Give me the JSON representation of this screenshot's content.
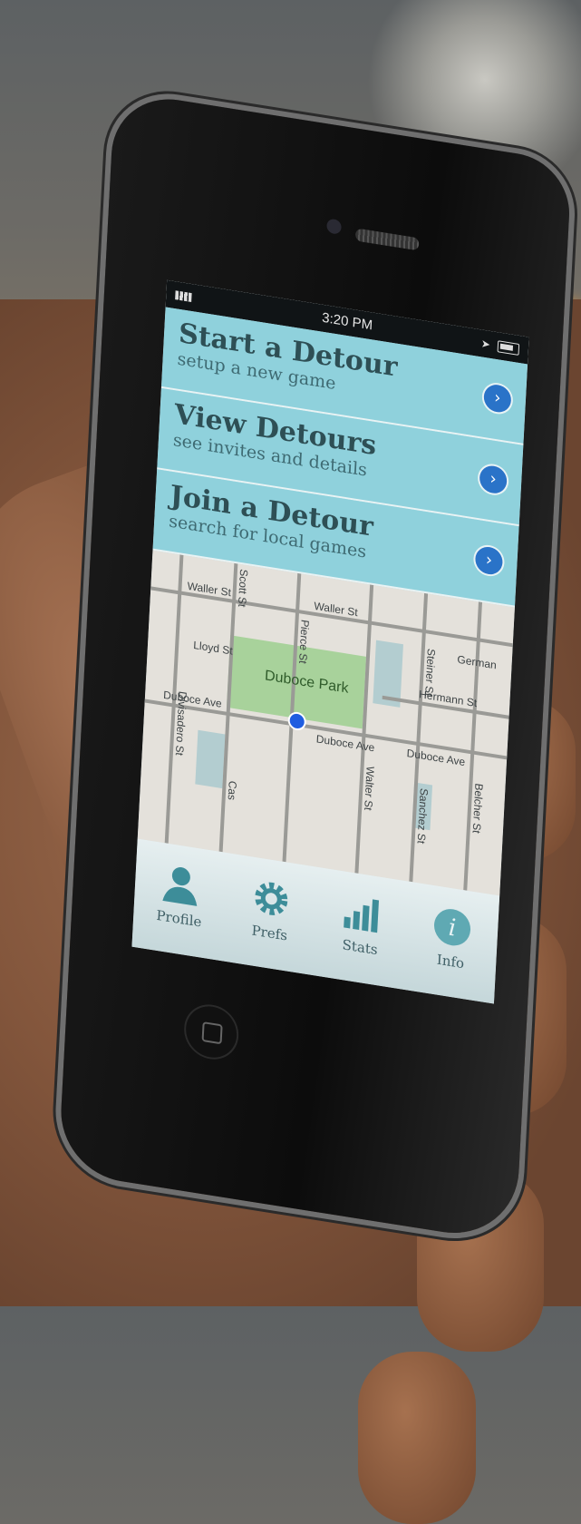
{
  "status_bar": {
    "time": "3:20 PM"
  },
  "menu": [
    {
      "title": "Start a Detour",
      "subtitle": "setup a new game"
    },
    {
      "title": "View Detours",
      "subtitle": "see invites and details"
    },
    {
      "title": "Join a Detour",
      "subtitle": "search for local games"
    }
  ],
  "map": {
    "park": "Duboce Park",
    "streets": {
      "waller_top_left": "Waller St",
      "waller_top_right": "Waller St",
      "scott": "Scott St",
      "pierce": "Pierce St",
      "lloyd": "Lloyd St",
      "duboce_left": "Duboce Ave",
      "duboce_mid": "Duboce Ave",
      "duboce_right": "Duboce Ave",
      "hermann": "Hermann St",
      "germania": "German",
      "steiner": "Steiner St",
      "divisadero": "Divisadero St",
      "walter": "Walter St",
      "sanchez": "Sanchez St",
      "belcher": "Belcher St",
      "castro": "Cas"
    }
  },
  "tabs": [
    {
      "label": "Profile",
      "icon": "person-icon"
    },
    {
      "label": "Prefs",
      "icon": "gear-icon"
    },
    {
      "label": "Stats",
      "icon": "bar-chart-icon"
    },
    {
      "label": "Info",
      "icon": "info-icon"
    }
  ],
  "colors": {
    "menu_bg": "#8fd1dc",
    "go_button": "#2a73c8",
    "park": "#a8d29b"
  }
}
